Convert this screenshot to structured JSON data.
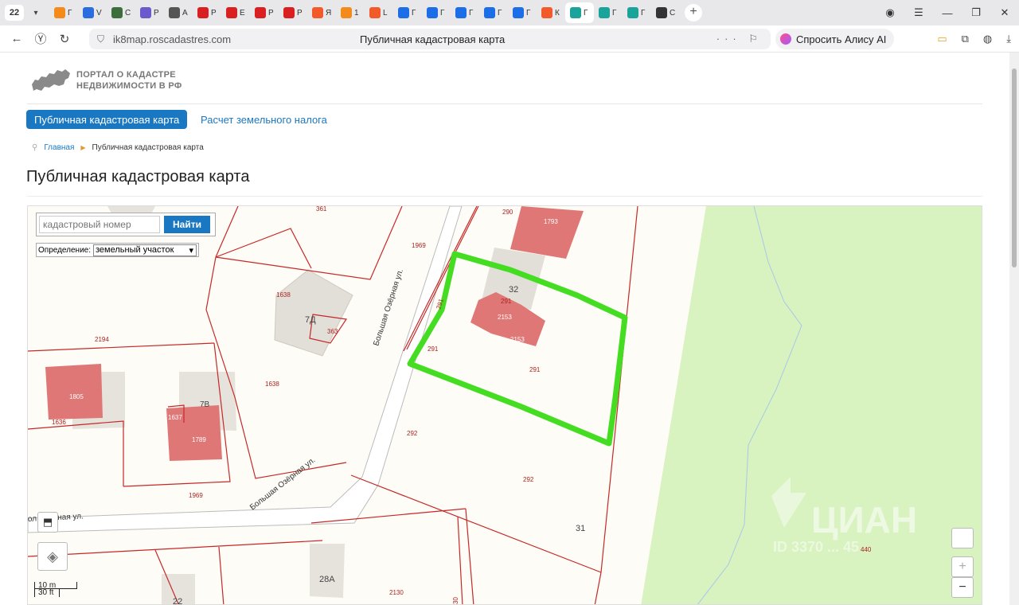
{
  "browser": {
    "tab_count": "22",
    "tabs": [
      {
        "letter": "Г",
        "color": "#f48a1a"
      },
      {
        "letter": "V",
        "color": "#2a6de0"
      },
      {
        "letter": "С",
        "color": "#3b6e3b"
      },
      {
        "letter": "Р",
        "color": "#6a5acd"
      },
      {
        "letter": "А",
        "color": "#555555"
      },
      {
        "letter": "Р",
        "color": "#d91f1f"
      },
      {
        "letter": "Е",
        "color": "#d91f1f"
      },
      {
        "letter": "Р",
        "color": "#d91f1f"
      },
      {
        "letter": "Р",
        "color": "#d91f1f"
      },
      {
        "letter": "Я",
        "color": "#f25a2a"
      },
      {
        "letter": "1",
        "color": "#f48a1a"
      },
      {
        "letter": "L",
        "color": "#f25a2a"
      },
      {
        "letter": "Г",
        "color": "#1c6ee8"
      },
      {
        "letter": "Г",
        "color": "#1c6ee8"
      },
      {
        "letter": "Г",
        "color": "#1c6ee8"
      },
      {
        "letter": "Г",
        "color": "#1c6ee8"
      },
      {
        "letter": "Г",
        "color": "#1c6ee8"
      },
      {
        "letter": "К",
        "color": "#f25a2a"
      },
      {
        "letter": "Г",
        "color": "#1aa39a"
      },
      {
        "letter": "Г",
        "color": "#1aa39a"
      },
      {
        "letter": "Г",
        "color": "#1aa39a"
      },
      {
        "letter": "С",
        "color": "#333333"
      }
    ],
    "url": "ik8map.roscadastres.com",
    "page_title": "Публичная кадастровая карта",
    "alice_label": "Спросить Алису AI"
  },
  "site": {
    "logo_line1": "ПОРТАЛ О КАДАСТРЕ",
    "logo_line2": "НЕДВИЖИМОСТИ В РФ",
    "nav_primary": "Публичная кадастровая карта",
    "nav_secondary": "Расчет земельного налога",
    "breadcrumb_home": "Главная",
    "breadcrumb_current": "Публичная кадастровая карта",
    "heading": "Публичная кадастровая карта"
  },
  "map": {
    "search_placeholder": "кадастровый номер",
    "search_button": "Найти",
    "definition_label": "Определение:",
    "definition_value": "земельный участок",
    "zoom_in": "+",
    "zoom_out": "−",
    "scale_m": "10 m",
    "scale_ft": "30 ft",
    "street_label_1": "Большая Озёрная ул.",
    "street_label_2": "Большая Озёрная ул.",
    "street_label_3": "ол Озёрная ул.",
    "parcel_labels": [
      "361",
      "290",
      "1793",
      "1969",
      "1638",
      "7Д",
      "363",
      "32",
      "291",
      "2153",
      "2153",
      "291",
      "2194",
      "1638",
      "291",
      "1805",
      "1636",
      "1637",
      "1789",
      "292",
      "292",
      "1969",
      "31",
      "28А",
      "2130",
      "22",
      "440",
      "30",
      "291"
    ],
    "house_label_7b": "7В",
    "watermark": "ЦИАН",
    "watermark_id": "ID 3370 ... 45",
    "colors": {
      "boundary": "#c62828",
      "building": "#e07777",
      "highlight": "#44dd22",
      "forest": "#d8f2c0"
    }
  }
}
